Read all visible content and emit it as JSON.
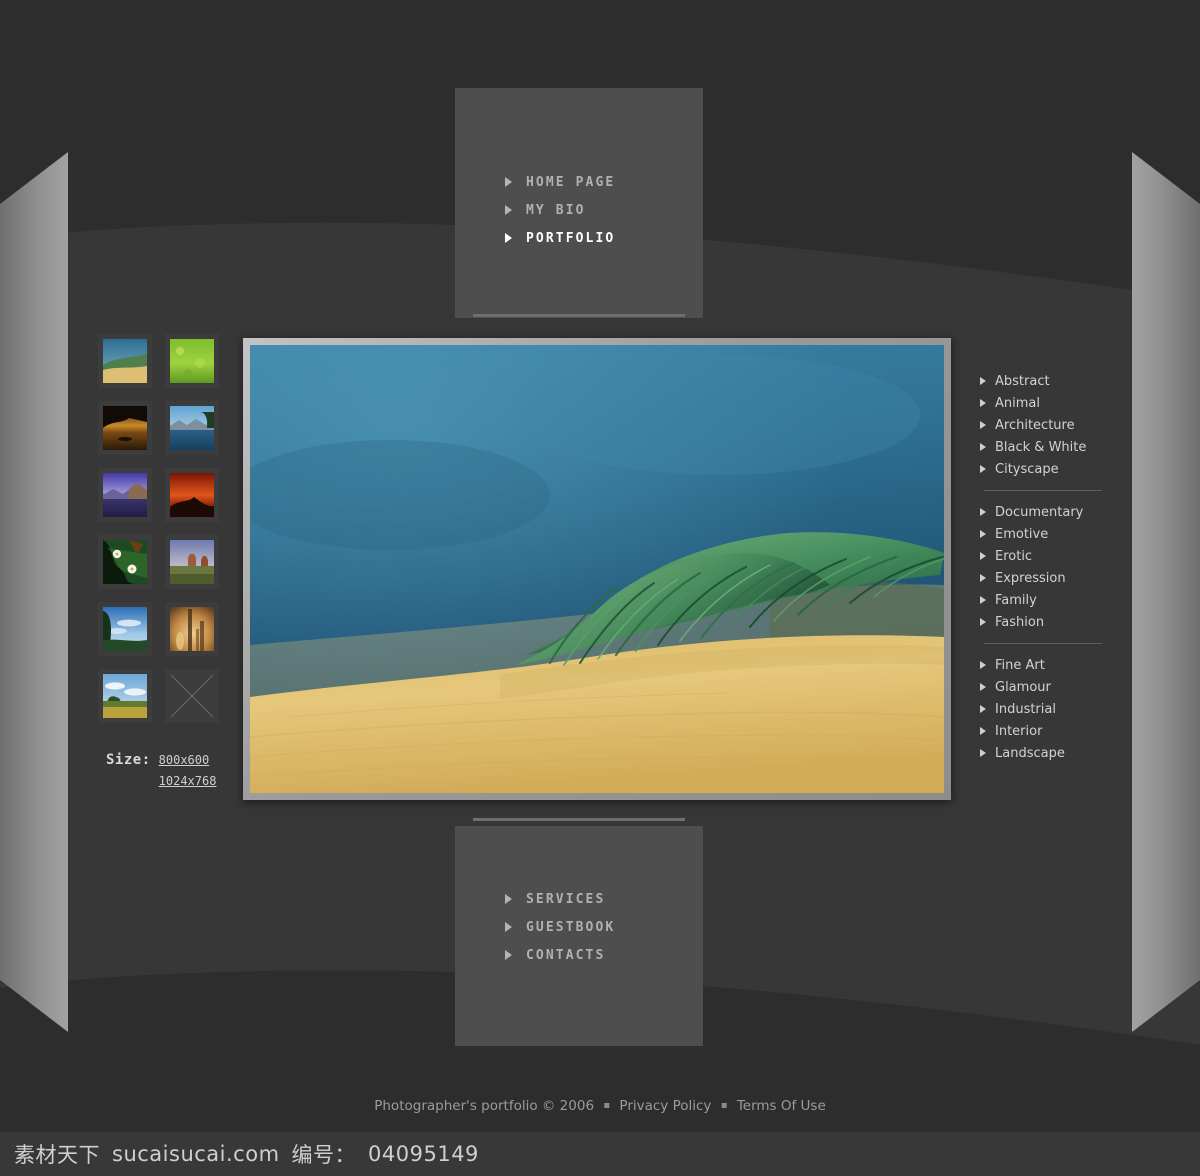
{
  "site": {
    "background_color": "#313131",
    "panel_color": "#4e4e4e",
    "accent_color": "#ffffff"
  },
  "nav_top": {
    "items": [
      {
        "label": "HOME PAGE",
        "active": false,
        "icon": "triangle-right-icon"
      },
      {
        "label": "MY BIO",
        "active": false,
        "icon": "triangle-right-icon"
      },
      {
        "label": "PORTFOLIO",
        "active": true,
        "icon": "triangle-right-icon"
      }
    ]
  },
  "nav_bottom": {
    "items": [
      {
        "label": "SERVICES",
        "active": false,
        "icon": "triangle-right-icon"
      },
      {
        "label": "GUESTBOOK",
        "active": false,
        "icon": "triangle-right-icon"
      },
      {
        "label": "CONTACTS",
        "active": false,
        "icon": "triangle-right-icon"
      }
    ]
  },
  "thumbnails": {
    "items": [
      {
        "name": "sand-dune-beach",
        "empty": false
      },
      {
        "name": "green-meadow",
        "empty": false
      },
      {
        "name": "sunset-lake-silhouette",
        "empty": false
      },
      {
        "name": "blue-river-mountains",
        "empty": false
      },
      {
        "name": "purple-dusk-lake",
        "empty": false
      },
      {
        "name": "red-sunset-hills",
        "empty": false
      },
      {
        "name": "white-flowers-foliage",
        "empty": false
      },
      {
        "name": "desert-buttes",
        "empty": false
      },
      {
        "name": "blue-sky-coast",
        "empty": false
      },
      {
        "name": "amber-cactus-dusk",
        "empty": false
      },
      {
        "name": "wheat-field-clouds",
        "empty": false
      },
      {
        "name": "empty-slot",
        "empty": true
      }
    ]
  },
  "size_selector": {
    "label": "Size:",
    "options": [
      "800x600",
      "1024x768"
    ]
  },
  "main_photo": {
    "alt": "Sand dune with green marram grass under deep blue sky",
    "sky_color": "#2f6f92",
    "sand_color": "#e0c173",
    "grass_color": "#4f8a52"
  },
  "categories": {
    "groups": [
      {
        "items": [
          "Abstract",
          "Animal",
          "Architecture",
          "Black & White",
          "Cityscape"
        ]
      },
      {
        "items": [
          "Documentary",
          "Emotive",
          "Erotic",
          "Expression",
          "Family",
          "Fashion"
        ]
      },
      {
        "items": [
          "Fine Art",
          "Glamour",
          "Industrial",
          "Interior",
          "Landscape"
        ]
      }
    ]
  },
  "footer": {
    "copyright": "Photographer's portfolio © 2006",
    "separator": "▪",
    "links": [
      "Privacy Policy",
      "Terms Of Use"
    ]
  },
  "watermark": {
    "site_cn": "素材天下",
    "site_url": "sucaisucai.com",
    "id_label": "编号：",
    "id_value": "04095149"
  }
}
